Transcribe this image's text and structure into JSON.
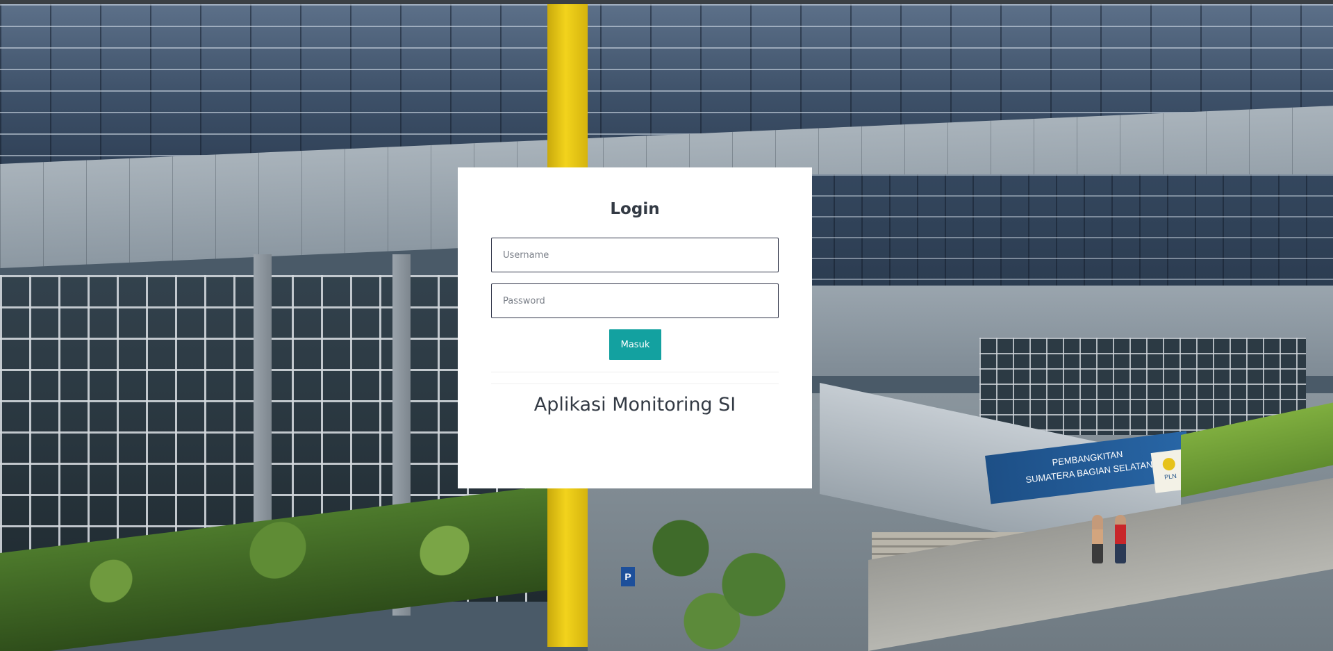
{
  "login": {
    "title": "Login",
    "username_placeholder": "Username",
    "password_placeholder": "Password",
    "submit_label": "Masuk",
    "app_name": "Aplikasi Monitoring SI"
  },
  "background": {
    "sign_line_1": "PEMBANGKITAN",
    "sign_line_2": "SUMATERA BAGIAN SELATAN",
    "sign_logo_text": "PLN",
    "parking_sign": "P"
  },
  "colors": {
    "accent": "#13a1a0",
    "card_background": "#ffffff",
    "text": "#333a44"
  }
}
